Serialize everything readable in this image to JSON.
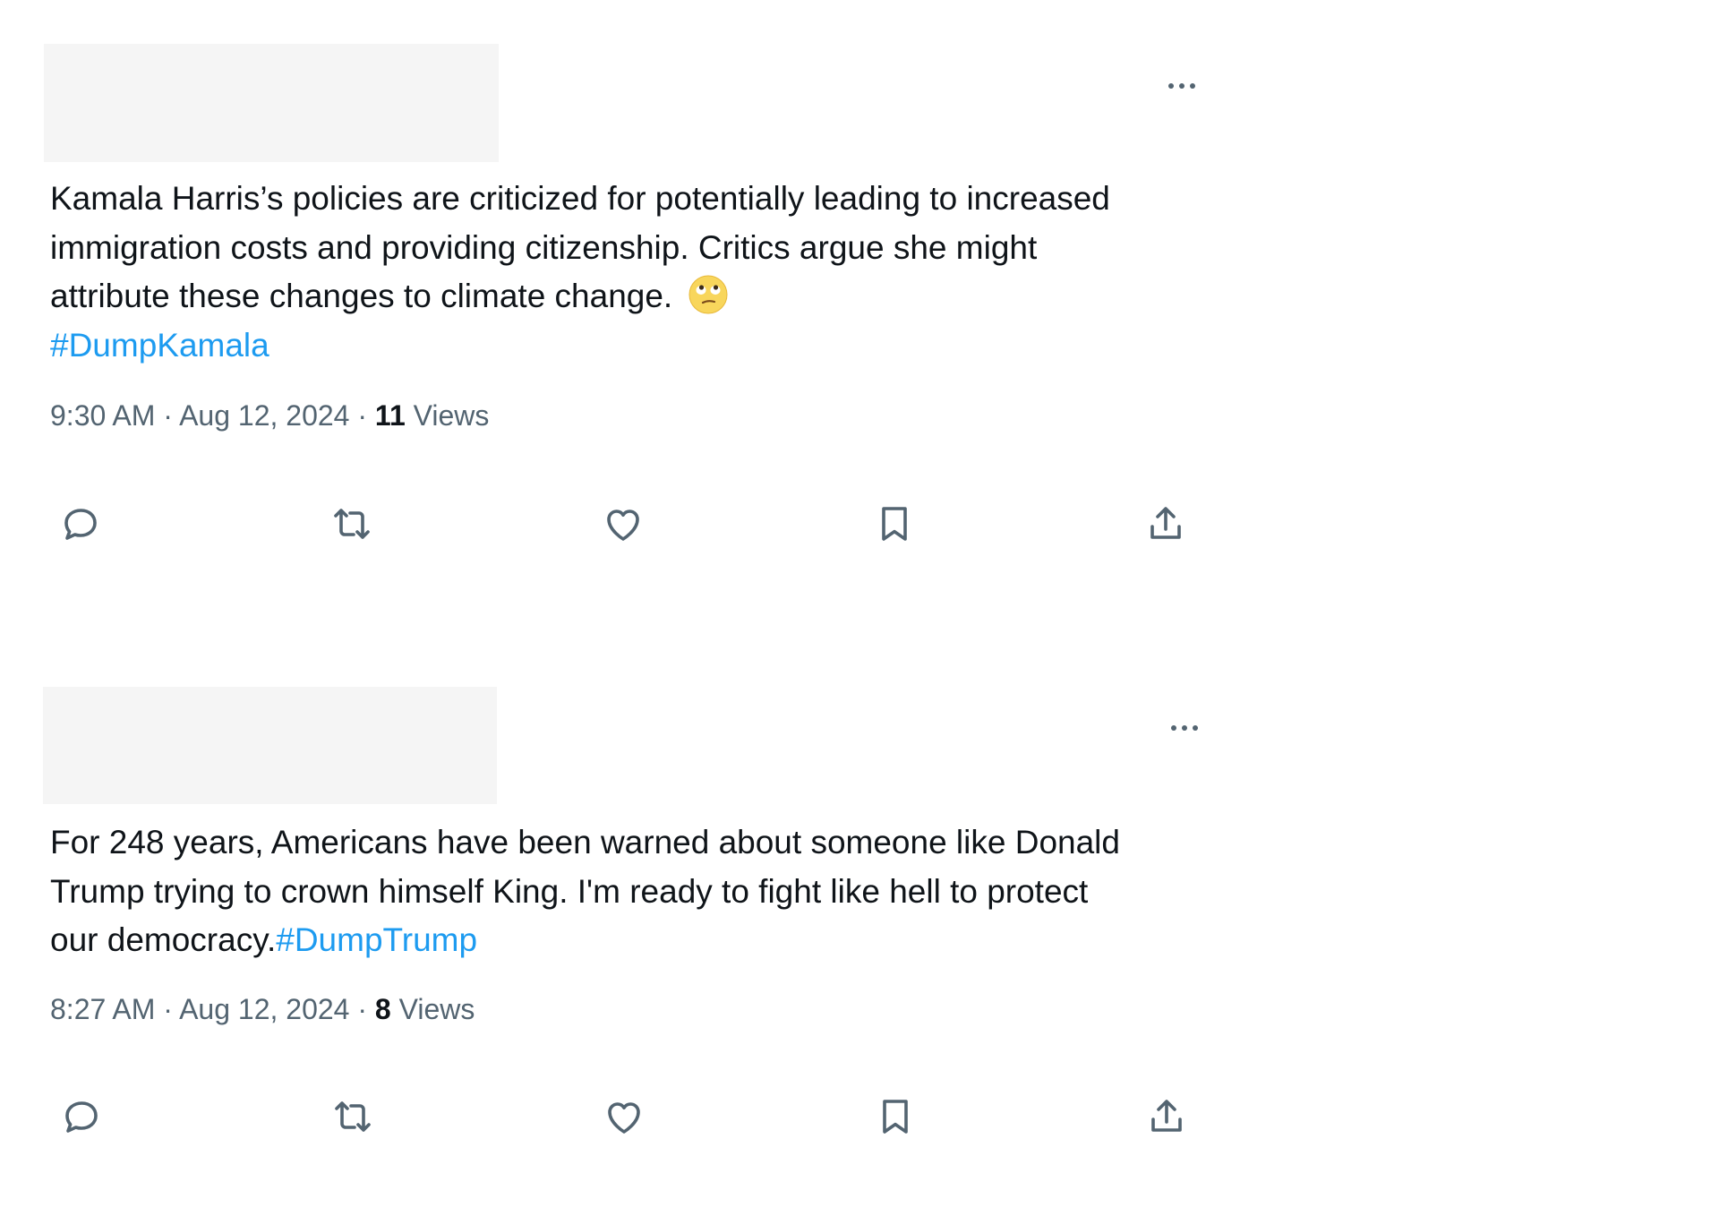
{
  "tweets": [
    {
      "header_redacted": true,
      "text": "Kamala Harris’s policies are criticized for potentially leading to increased\nimmigration costs and providing citizenship. Critics argue she might\nattribute these changes to climate change. ",
      "emoji": "face-with-rolling-eyes-icon",
      "hashtag": "#DumpKamala",
      "time": "9:30 AM",
      "separator": " · ",
      "date": "Aug 12, 2024",
      "views_count": "11",
      "views_label": " Views",
      "actions": [
        "reply-icon",
        "repost-icon",
        "like-icon",
        "bookmark-icon",
        "share-icon"
      ]
    },
    {
      "header_redacted": true,
      "text": "For 248 years, Americans have been warned about someone like Donald\nTrump trying to crown himself King. I'm ready to fight like hell to protect\nour democracy.",
      "hashtag": "#DumpTrump",
      "time": "8:27 AM",
      "separator": " · ",
      "date": "Aug 12, 2024",
      "views_count": "8",
      "views_label": " Views",
      "actions": [
        "reply-icon",
        "repost-icon",
        "like-icon",
        "bookmark-icon",
        "share-icon"
      ]
    }
  ],
  "colors": {
    "text": "#0f1419",
    "secondary": "#536471",
    "hashtag": "#1d9bf0",
    "redacted": "#f5f5f5"
  }
}
